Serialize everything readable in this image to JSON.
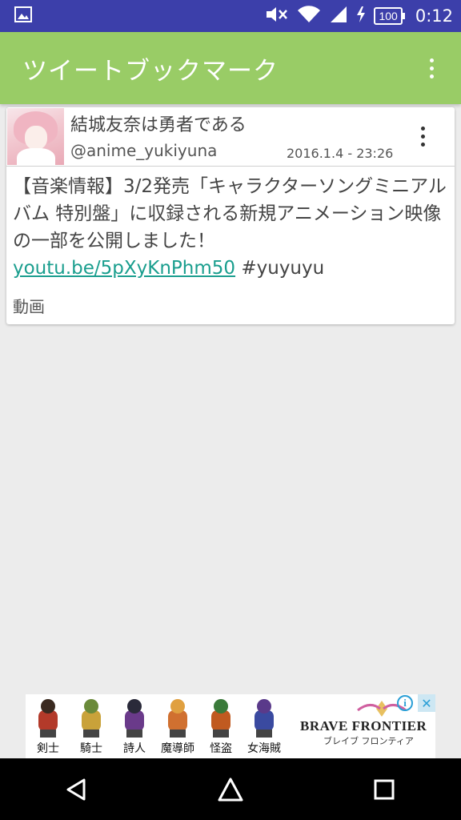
{
  "status_bar": {
    "battery": "100",
    "time": "0:12"
  },
  "app_bar": {
    "title": "ツイートブックマーク"
  },
  "tweet": {
    "user_name": "結城友奈は勇者である",
    "user_handle": "@anime_yukiyuna",
    "timestamp": "2016.1.4 - 23:26",
    "text_before": "【音楽情報】3/2発売「キャラクターソングミニアルバム 特別盤」に収録される新規アニメーション映像の一部を公開しました！",
    "link": "youtu.be/5pXyKnPhm50",
    "hashtag": " #yuyuyu",
    "media_label": "動画"
  },
  "ad": {
    "characters": [
      {
        "label": "剣士",
        "color": "#b33a2a",
        "hair": "#3a2a20"
      },
      {
        "label": "騎士",
        "color": "#c9a23a",
        "hair": "#6a8a3a"
      },
      {
        "label": "詩人",
        "color": "#6a3a8a",
        "hair": "#2a2a3a"
      },
      {
        "label": "魔導師",
        "color": "#d07030",
        "hair": "#e0a040"
      },
      {
        "label": "怪盗",
        "color": "#c05a20",
        "hair": "#3a7a3a"
      },
      {
        "label": "女海賊",
        "color": "#3a4aa0",
        "hair": "#5a3a8a"
      }
    ],
    "logo_main": "BRAVE FRONTIER",
    "logo_sub": "ブレイブ フロンティア",
    "info_icon": "i",
    "close_icon": "✕"
  }
}
